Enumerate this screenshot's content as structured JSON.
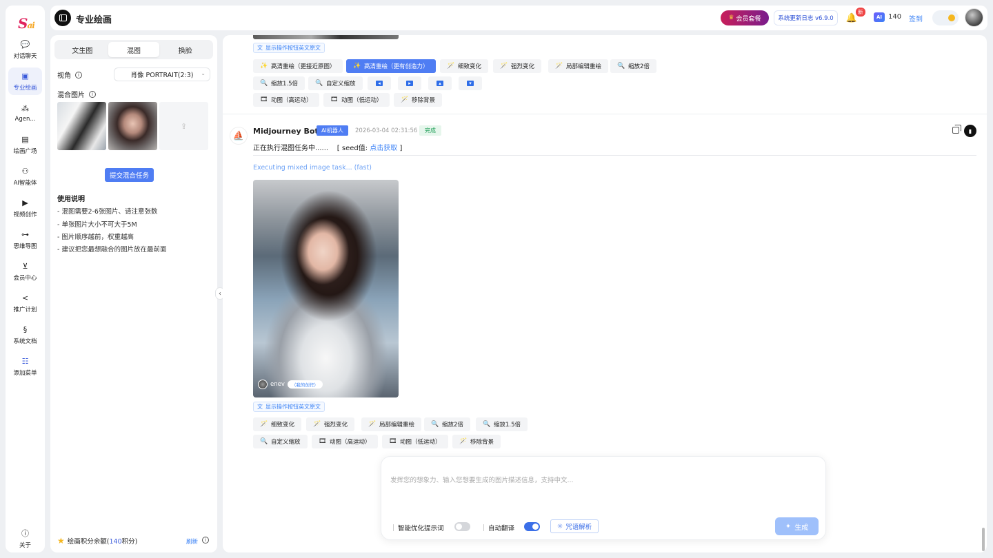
{
  "app": {
    "logo_text": "S",
    "logo_sub": "ai",
    "page_title": "专业绘画"
  },
  "rail": {
    "items": [
      {
        "label": "对话聊天",
        "icon": "chat-icon"
      },
      {
        "label": "专业绘画",
        "icon": "paint-icon",
        "active": true
      },
      {
        "label": "Agen...",
        "icon": "agent-icon"
      },
      {
        "label": "绘画广场",
        "icon": "gallery-icon"
      },
      {
        "label": "AI智能体",
        "icon": "ai-bot-icon"
      },
      {
        "label": "视频创作",
        "icon": "video-icon"
      },
      {
        "label": "思维导图",
        "icon": "mindmap-icon"
      },
      {
        "label": "会员中心",
        "icon": "cart-icon"
      },
      {
        "label": "推广计划",
        "icon": "share-icon"
      },
      {
        "label": "系统文档",
        "icon": "doc-icon"
      },
      {
        "label": "添加菜单",
        "icon": "add-menu-icon"
      }
    ],
    "about": "关于"
  },
  "header": {
    "vip": "会员套餐",
    "changelog": "系统更新日志 v6.9.0",
    "new_badge": "新",
    "ai_label": "AI",
    "credits": "140",
    "checkin": "签到"
  },
  "panel": {
    "tabs": [
      "文生图",
      "混图",
      "换脸"
    ],
    "active_tab": 1,
    "view_label": "视角",
    "view_value": "肖像 PORTRAIT(2:3)",
    "mix_label": "混合图片",
    "submit": "提交混合任务",
    "usage_title": "使用说明",
    "usage": [
      "- 混图需要2-6张图片、请注意张数",
      "- 单张图片大小不可大于5M",
      "- 图片顺序越前，权重越高",
      "- 建议把您最想融合的图片放在最前面"
    ],
    "credit_prefix": "绘画积分余额(",
    "credit_value": "140",
    "credit_suffix": "积分)",
    "refresh": "刷新"
  },
  "chat": {
    "show_en": "显示操作按钮英文原文",
    "prev_actions_row1": [
      "高清重绘（更接近原图）",
      "高清重绘（更有创造力）",
      "细致变化",
      "强烈变化",
      "局部编辑重绘",
      "缩放2倍"
    ],
    "prev_actions_row2": [
      "缩放1.5倍",
      "自定义缩放"
    ],
    "prev_actions_row3": [
      "动图（高运动）",
      "动图（低运动）",
      "移除背景"
    ],
    "bot_name": "Midjourney Bot",
    "bot_tag": "AI机器人",
    "bot_time": "2026-03-04 02:31:56",
    "bot_status": "完成",
    "msg_prefix": "正在执行混图任务中......",
    "seed_prefix": "[ seed值: ",
    "seed_link": "点击获取",
    "seed_suffix": " ]",
    "exec_text": "Executing mixed image task...  (fast)",
    "image_author": "enev",
    "image_mine": "（我的创作）",
    "actions_row1": [
      "细致变化",
      "强烈变化",
      "局部编辑重绘",
      "缩放2倍",
      "缩放1.5倍"
    ],
    "actions_row2": [
      "自定义缩放",
      "动图（高运动）",
      "动图（低运动）",
      "移除背景"
    ]
  },
  "composer": {
    "placeholder": "发挥您的想象力、输入您想要生成的图片描述信息，支持中文...",
    "opt_optimize": "智能优化提示词",
    "optimize_on": false,
    "opt_translate": "自动翻译",
    "translate_on": true,
    "parse": "咒语解析",
    "generate": "生成"
  },
  "colors": {
    "accent": "#4f7df3",
    "vip_start": "#c81f5a",
    "vip_end": "#7a1d8c",
    "success": "#22a05a"
  }
}
